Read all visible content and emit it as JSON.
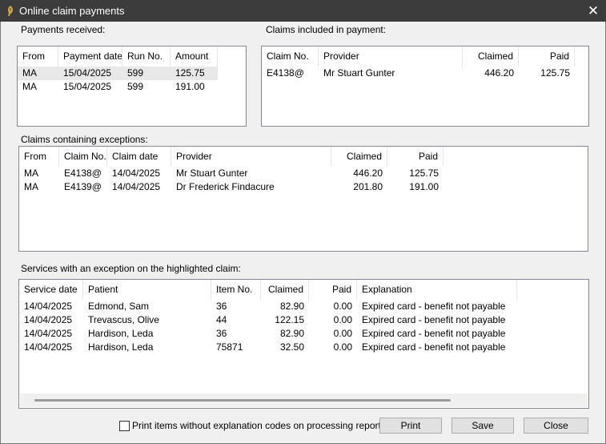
{
  "window": {
    "title": "Online claim payments",
    "icon": "app-logo-icon",
    "close_glyph": "✕"
  },
  "payments_received": {
    "label": "Payments received:",
    "columns": [
      "From",
      "Payment date",
      "Run No.",
      "Amount"
    ],
    "rows": [
      [
        "MA",
        "15/04/2025",
        "599",
        "125.75"
      ],
      [
        "MA",
        "15/04/2025",
        "599",
        "191.00"
      ]
    ]
  },
  "claims_in_payment": {
    "label": "Claims included in payment:",
    "columns": [
      "Claim No.",
      "Provider",
      "Claimed",
      "Paid"
    ],
    "rows": [
      [
        "E4138@",
        "Mr Stuart Gunter",
        "446.20",
        "125.75"
      ]
    ]
  },
  "claims_exceptions": {
    "label": "Claims containing exceptions:",
    "columns": [
      "From",
      "Claim No.",
      "Claim date",
      "Provider",
      "Claimed",
      "Paid"
    ],
    "rows": [
      [
        "MA",
        "E4138@",
        "14/04/2025",
        "Mr Stuart Gunter",
        "446.20",
        "125.75"
      ],
      [
        "MA",
        "E4139@",
        "14/04/2025",
        "Dr Frederick Findacure",
        "201.80",
        "191.00"
      ]
    ]
  },
  "services_exceptions": {
    "label": "Services with an exception on the highlighted claim:",
    "columns": [
      "Service date",
      "Patient",
      "Item No.",
      "Claimed",
      "Paid",
      "Explanation"
    ],
    "rows": [
      [
        "14/04/2025",
        "Edmond, Sam",
        "36",
        "82.90",
        "0.00",
        "Expired card - benefit not payable"
      ],
      [
        "14/04/2025",
        "Trevascus, Olive",
        "44",
        "122.15",
        "0.00",
        "Expired card - benefit not payable"
      ],
      [
        "14/04/2025",
        "Hardison, Leda",
        "36",
        "82.90",
        "0.00",
        "Expired card - benefit not payable"
      ],
      [
        "14/04/2025",
        "Hardison, Leda",
        "75871",
        "32.50",
        "0.00",
        "Expired card - benefit not payable"
      ]
    ]
  },
  "footer": {
    "print_checkbox_label": "Print items without explanation codes on processing reports",
    "print_checkbox_checked": false,
    "print_label": "Print",
    "save_label": "Save",
    "close_label": "Close"
  }
}
